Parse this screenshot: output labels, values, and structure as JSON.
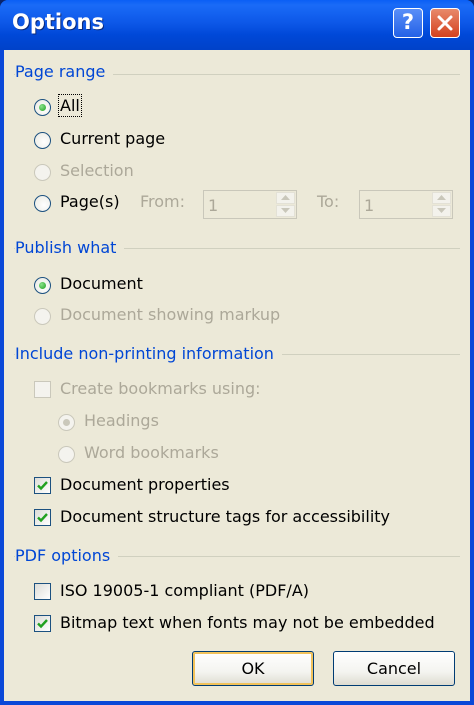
{
  "window": {
    "title": "Options"
  },
  "titlebar": {
    "help_label": "?",
    "help_icon": "question-icon",
    "close_icon": "close-x-icon"
  },
  "page_range": {
    "group_label": "Page range",
    "all_label": "All",
    "current_page_label": "Current page",
    "selection_label": "Selection",
    "pages_label": "Page(s)",
    "from_label": "From:",
    "from_value": "1",
    "to_label": "To:",
    "to_value": "1",
    "selected": "all"
  },
  "publish_what": {
    "group_label": "Publish what",
    "document_label": "Document",
    "markup_label": "Document showing markup",
    "selected": "document"
  },
  "non_printing": {
    "group_label": "Include non-printing information",
    "create_bookmarks_label": "Create bookmarks using:",
    "headings_label": "Headings",
    "word_bookmarks_label": "Word bookmarks",
    "doc_properties_label": "Document properties",
    "structure_tags_label": "Document structure tags for accessibility",
    "create_bookmarks_checked": false,
    "doc_properties_checked": true,
    "structure_tags_checked": true
  },
  "pdf_options": {
    "group_label": "PDF options",
    "iso_label": "ISO 19005-1 compliant (PDF/A)",
    "bitmap_label": "Bitmap text when fonts may not be embedded",
    "iso_checked": false,
    "bitmap_checked": true
  },
  "buttons": {
    "ok_label": "OK",
    "cancel_label": "Cancel"
  },
  "colors": {
    "title_bar": "#0054e3",
    "group_label": "#0046d5",
    "dialog_bg": "#ece9d8",
    "check_green": "#21a121"
  }
}
